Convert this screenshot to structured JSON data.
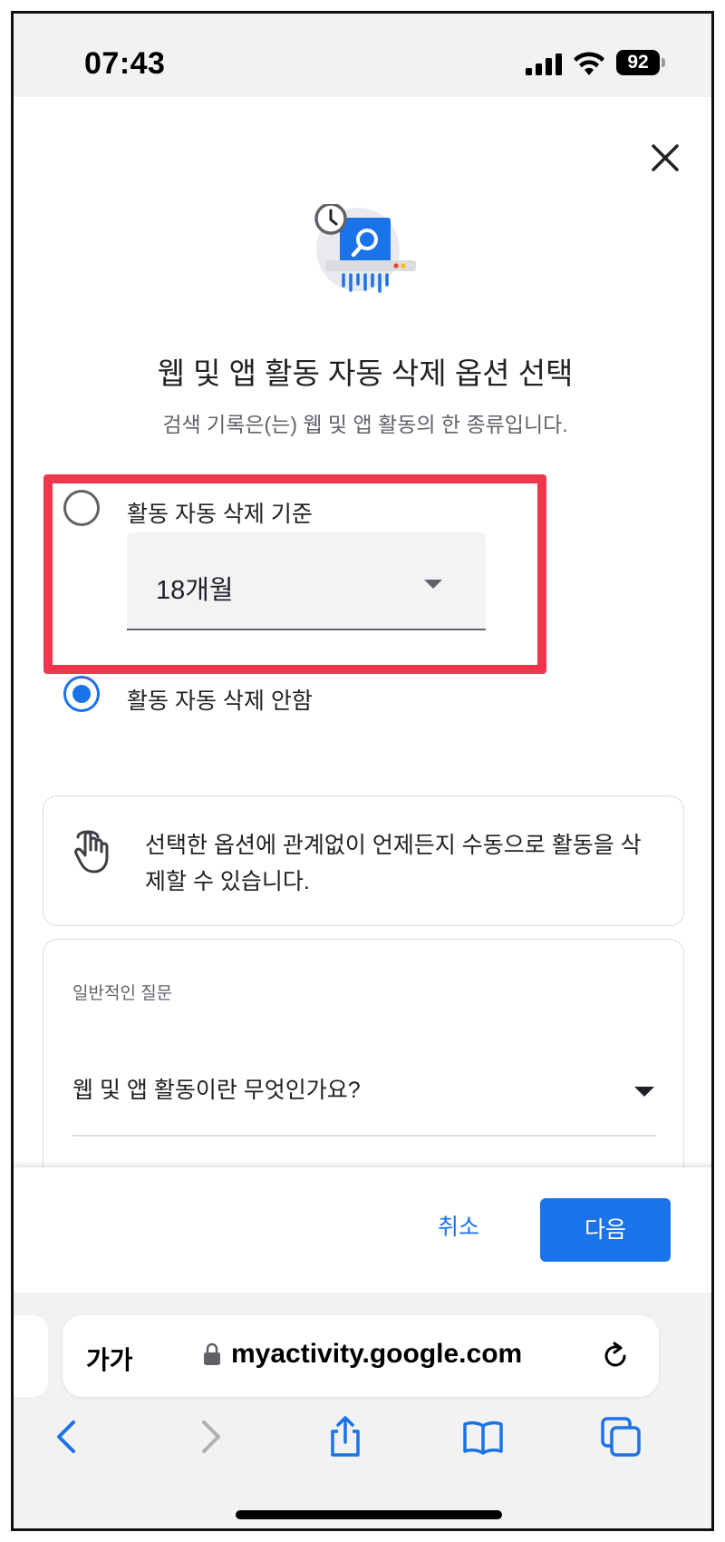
{
  "status_bar": {
    "time": "07:43",
    "battery": "92"
  },
  "dialog": {
    "title": "웹 및 앱 활동 자동 삭제 옵션 선택",
    "subtitle": "검색 기록은(는) 웹 및 앱 활동의 한 종류입니다.",
    "options": [
      {
        "label": "활동 자동 삭제 기준",
        "selected": false
      },
      {
        "label": "활동 자동 삭제 안함",
        "selected": true
      }
    ],
    "auto_delete_period": "18개월",
    "info_text": "선택한 옵션에 관계없이 언제든지 수동으로 활동을 삭제할 수 있습니다.",
    "faq": {
      "heading": "일반적인 질문",
      "question": "웹 및 앱 활동이란 무엇인가요?"
    },
    "cancel_label": "취소",
    "next_label": "다음"
  },
  "browser": {
    "font_size_label": "가가",
    "url": "myactivity.google.com"
  },
  "colors": {
    "accent": "#1a73e8",
    "highlight": "#f0364d"
  },
  "icons": [
    "close-icon",
    "shredder-history-icon",
    "hand-tap-icon",
    "lock-icon",
    "reload-icon",
    "back-icon",
    "forward-icon",
    "share-icon",
    "bookmarks-icon",
    "tabs-icon"
  ]
}
